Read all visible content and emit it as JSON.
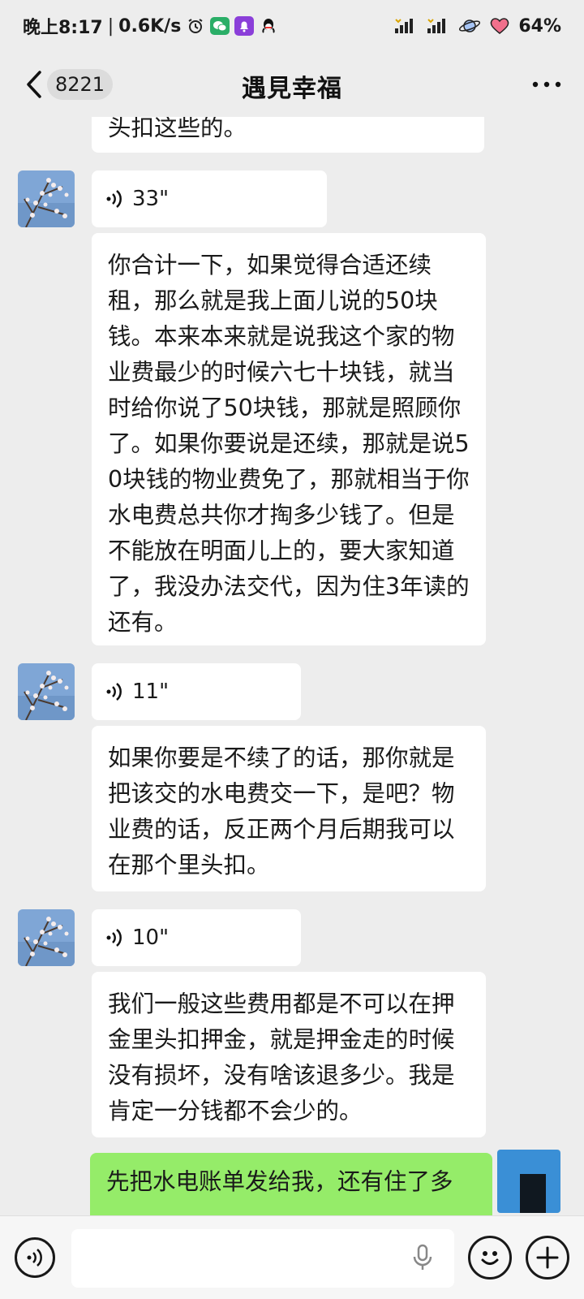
{
  "status_bar": {
    "time": "晚上8:17",
    "network_speed": "0.6K/s",
    "battery": "64%"
  },
  "nav": {
    "unread_count": "8221",
    "title": "遇見幸福"
  },
  "messages": [
    {
      "type": "text",
      "side": "left",
      "text": "头扣这些的。"
    },
    {
      "type": "voice",
      "side": "left",
      "duration": "33\""
    },
    {
      "type": "text",
      "side": "left",
      "text": "你合计一下，如果觉得合适还续租，那么就是我上面儿说的50块钱。本来本来就是说我这个家的物业费最少的时候六七十块钱，就当时给你说了50块钱，那就是照顾你了。如果你要说是还续，那就是说50块钱的物业费免了，那就相当于你水电费总共你才掏多少钱了。但是不能放在明面儿上的，要大家知道了，我没办法交代，因为住3年读的还有。"
    },
    {
      "type": "voice",
      "side": "left",
      "duration": "11\""
    },
    {
      "type": "text",
      "side": "left",
      "text": "如果你要是不续了的话，那你就是把该交的水电费交一下，是吧？物业费的话，反正两个月后期我可以在那个里头扣。"
    },
    {
      "type": "voice",
      "side": "left",
      "duration": "10\""
    },
    {
      "type": "text",
      "side": "left",
      "text": "我们一般这些费用都是不可以在押金里头扣押金，就是押金走的时候没有损坏，没有啥该退多少。我是肯定一分钱都不会少的。"
    },
    {
      "type": "text",
      "side": "right",
      "text": "先把水电账单发给我，还有住了多"
    }
  ],
  "icons": {
    "back": "chevron-left-icon",
    "more": "more-dots-icon",
    "voice": "voice-wave-icon",
    "emoji": "smiley-icon",
    "plus": "plus-icon",
    "mic": "microphone-icon"
  },
  "colors": {
    "background": "#ededed",
    "bubble_in": "#ffffff",
    "bubble_out": "#95ec69",
    "input_bar": "#f6f6f6"
  }
}
